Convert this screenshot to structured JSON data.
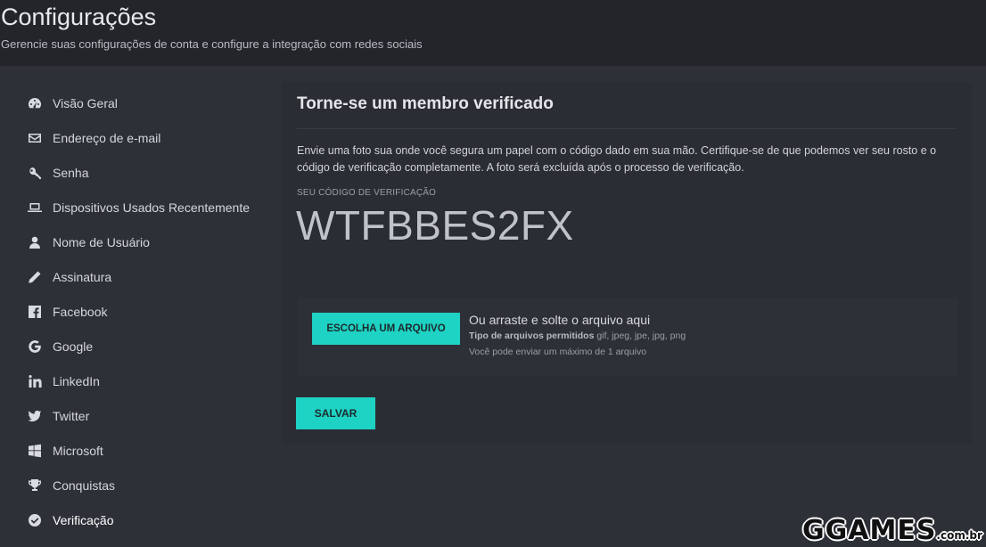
{
  "header": {
    "title": "Configurações",
    "subtitle": "Gerencie suas configurações de conta e configure a integração com redes sociais"
  },
  "sidebar": {
    "items": [
      {
        "label": "Visão Geral",
        "icon": "dashboard-icon"
      },
      {
        "label": "Endereço de e-mail",
        "icon": "envelope-icon"
      },
      {
        "label": "Senha",
        "icon": "key-icon"
      },
      {
        "label": "Dispositivos Usados Recentemente",
        "icon": "laptop-icon"
      },
      {
        "label": "Nome de Usuário",
        "icon": "user-icon"
      },
      {
        "label": "Assinatura",
        "icon": "pencil-icon"
      },
      {
        "label": "Facebook",
        "icon": "facebook-icon"
      },
      {
        "label": "Google",
        "icon": "google-icon"
      },
      {
        "label": "LinkedIn",
        "icon": "linkedin-icon"
      },
      {
        "label": "Twitter",
        "icon": "twitter-icon"
      },
      {
        "label": "Microsoft",
        "icon": "windows-icon"
      },
      {
        "label": "Conquistas",
        "icon": "trophy-icon"
      },
      {
        "label": "Verificação",
        "icon": "check-circle-icon",
        "active": true
      }
    ]
  },
  "card": {
    "title": "Torne-se um membro verificado",
    "description": "Envie uma foto sua onde você segura um papel com o código dado em sua mão. Certifique-se de que podemos ver seu rosto e o código de verificação completamente. A foto será excluída após o processo de verificação.",
    "code_label": "SEU CÓDIGO DE VERIFICAÇÃO",
    "code_value": "WTFBBES2FX",
    "upload": {
      "button_label": "ESCOLHA UM ARQUIVO",
      "drop_text": "Ou arraste e solte o arquivo aqui",
      "types_label": "Tipo de arquivos permitidos",
      "types_value": "gif, jpeg, jpe, jpg, png",
      "max_text": "Você pode enviar um máximo de 1 arquivo"
    },
    "save_label": "SALVAR"
  },
  "watermark": {
    "main": "GGAMES",
    "suffix": ".com.br"
  },
  "colors": {
    "accent": "#1ed2c4",
    "background": "#24252a",
    "panel": "#2e3038",
    "card": "#2b2d34"
  }
}
